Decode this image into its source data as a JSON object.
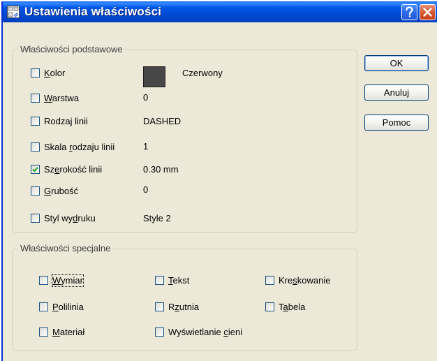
{
  "window": {
    "title": "Ustawienia właściwości",
    "help_button": "?",
    "close_button": "✕",
    "icon": "settings-dialog-icon"
  },
  "basic_properties": {
    "legend": "Właściwości podstawowe",
    "items": [
      {
        "label_pre": "",
        "label_accel": "K",
        "label_post": "olor",
        "checked": false,
        "value": "Czerwony",
        "swatch_color": "#474747"
      },
      {
        "label_pre": "",
        "label_accel": "W",
        "label_post": "arstwa",
        "checked": false,
        "value": "0"
      },
      {
        "label_pre": "Rodzaj linii",
        "label_accel": "",
        "label_post": "",
        "checked": false,
        "value": "DASHED"
      },
      {
        "label_pre": "Skala ",
        "label_accel": "r",
        "label_post": "odzaju linii",
        "checked": false,
        "value": "1"
      },
      {
        "label_pre": "Sz",
        "label_accel": "e",
        "label_post": "rokość linii",
        "checked": true,
        "value": "0.30 mm"
      },
      {
        "label_pre": "",
        "label_accel": "G",
        "label_post": "rubość",
        "checked": false,
        "value": "0"
      },
      {
        "label_pre": "Styl wy",
        "label_accel": "d",
        "label_post": "ruku",
        "checked": false,
        "value": "Style 2"
      }
    ]
  },
  "special_properties": {
    "legend": "Właściwości specjalne",
    "items": [
      {
        "label_pre": "",
        "label_accel": "W",
        "label_post": "ymiar",
        "checked": false
      },
      {
        "label_pre": "",
        "label_accel": "T",
        "label_post": "ekst",
        "checked": false
      },
      {
        "label_pre": "Kre",
        "label_accel": "s",
        "label_post": "kowanie",
        "checked": false
      },
      {
        "label_pre": "",
        "label_accel": "P",
        "label_post": "olilinia",
        "checked": false
      },
      {
        "label_pre": "R",
        "label_accel": "z",
        "label_post": "utnia",
        "checked": false
      },
      {
        "label_pre": "T",
        "label_accel": "a",
        "label_post": "bela",
        "checked": false
      },
      {
        "label_pre": "",
        "label_accel": "M",
        "label_post": "ateriał",
        "checked": false
      },
      {
        "label_pre": "Wyświetlanie ",
        "label_accel": "c",
        "label_post": "ieni",
        "checked": false
      }
    ]
  },
  "buttons": {
    "ok": "OK",
    "cancel": "Anuluj",
    "help": "Pomoc"
  },
  "colors": {
    "titlebar": "#0055e5",
    "dialog_face": "#ece9d8",
    "checkmark": "#21a121",
    "swatch": "#474747"
  }
}
